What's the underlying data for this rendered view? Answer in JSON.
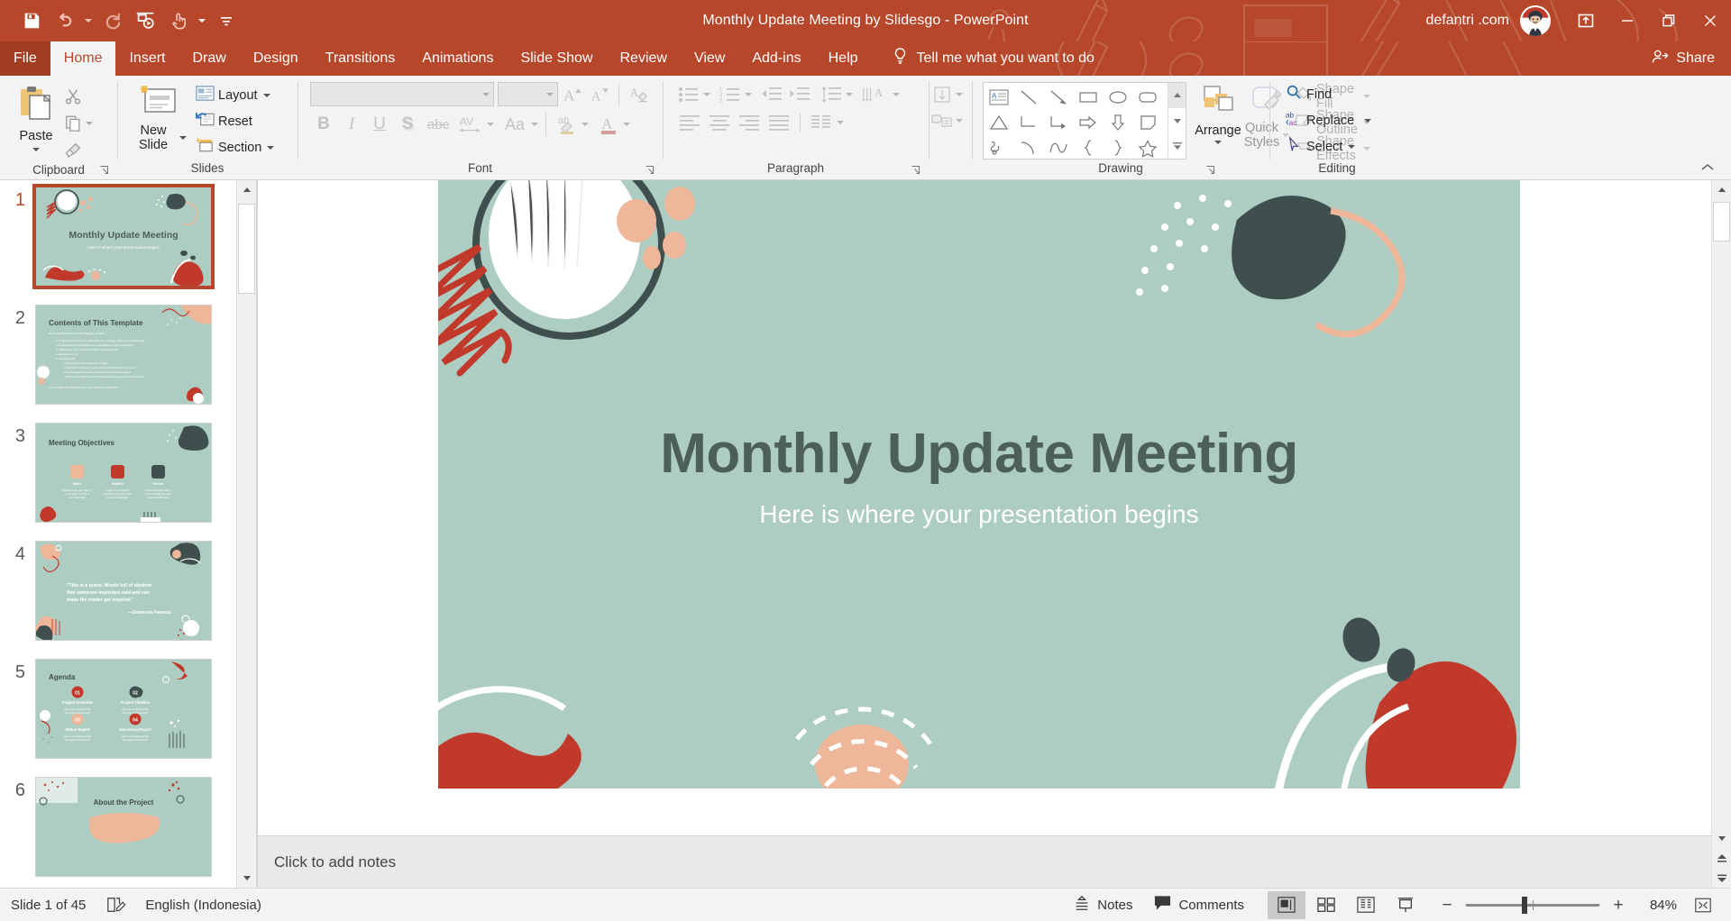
{
  "app": {
    "title": "Monthly Update Meeting by Slidesgo  -  PowerPoint",
    "account_name": "defantri .com",
    "brand_color": "#b7472a",
    "avatar_name": "user-avatar"
  },
  "quick_access": {
    "items": [
      {
        "name": "save-icon",
        "label": "Save"
      },
      {
        "name": "undo-icon",
        "label": "Undo"
      },
      {
        "name": "redo-icon",
        "label": "Redo"
      },
      {
        "name": "start-presentation-icon",
        "label": "Start From Beginning"
      },
      {
        "name": "touch-mode-icon",
        "label": "Touch/Mouse Mode"
      },
      {
        "name": "customize-quick-access-icon",
        "label": "Customize Quick Access Toolbar"
      }
    ]
  },
  "window_controls": [
    {
      "name": "ribbon-display-options-icon",
      "label": "Ribbon Display Options"
    },
    {
      "name": "minimize-icon",
      "label": "Minimize"
    },
    {
      "name": "restore-icon",
      "label": "Restore Down"
    },
    {
      "name": "close-icon",
      "label": "Close"
    }
  ],
  "tabs": [
    {
      "label": "File",
      "active": false,
      "file": true
    },
    {
      "label": "Home",
      "active": true
    },
    {
      "label": "Insert",
      "active": false
    },
    {
      "label": "Draw",
      "active": false
    },
    {
      "label": "Design",
      "active": false
    },
    {
      "label": "Transitions",
      "active": false
    },
    {
      "label": "Animations",
      "active": false
    },
    {
      "label": "Slide Show",
      "active": false
    },
    {
      "label": "Review",
      "active": false
    },
    {
      "label": "View",
      "active": false
    },
    {
      "label": "Add-ins",
      "active": false
    },
    {
      "label": "Help",
      "active": false
    }
  ],
  "tell_me": {
    "label": "Tell me what you want to do",
    "icon": "lightbulb-icon"
  },
  "share": {
    "label": "Share",
    "icon": "share-person-icon"
  },
  "ribbon": {
    "collapse_label": "Collapse the Ribbon",
    "groups": [
      {
        "name": "clipboard",
        "label": "Clipboard",
        "paste": "Paste",
        "items": [
          {
            "name": "cut-icon",
            "label": "Cut"
          },
          {
            "name": "copy-icon",
            "label": "Copy"
          },
          {
            "name": "format-painter-icon",
            "label": "Format Painter"
          }
        ]
      },
      {
        "name": "slides",
        "label": "Slides",
        "new_slide": "New Slide",
        "items": [
          {
            "name": "layout-button",
            "label": "Layout"
          },
          {
            "name": "reset-button",
            "label": "Reset"
          },
          {
            "name": "section-button",
            "label": "Section"
          }
        ]
      },
      {
        "name": "font",
        "label": "Font",
        "font_name_value": "",
        "font_size_value": "",
        "items": [
          {
            "name": "increase-font-size-icon",
            "label": "Increase Font Size"
          },
          {
            "name": "decrease-font-size-icon",
            "label": "Decrease Font Size"
          },
          {
            "name": "clear-formatting-icon",
            "label": "Clear All Formatting"
          },
          {
            "name": "bold-icon",
            "label": "B"
          },
          {
            "name": "italic-icon",
            "label": "I"
          },
          {
            "name": "underline-icon",
            "label": "U"
          },
          {
            "name": "text-shadow-icon",
            "label": "S"
          },
          {
            "name": "strikethrough-icon",
            "label": "abc"
          },
          {
            "name": "character-spacing-icon",
            "label": "AV"
          },
          {
            "name": "change-case-icon",
            "label": "Aa"
          },
          {
            "name": "text-highlight-color-icon",
            "label": "Text Highlight Color"
          },
          {
            "name": "font-color-icon",
            "label": "Font Color"
          }
        ]
      },
      {
        "name": "paragraph",
        "label": "Paragraph",
        "items": [
          {
            "name": "bullets-icon",
            "label": "Bullets"
          },
          {
            "name": "numbering-icon",
            "label": "Numbering"
          },
          {
            "name": "decrease-indent-icon",
            "label": "Decrease List Level"
          },
          {
            "name": "increase-indent-icon",
            "label": "Increase List Level"
          },
          {
            "name": "line-spacing-icon",
            "label": "Line Spacing"
          },
          {
            "name": "text-direction-icon",
            "label": "Text Direction"
          },
          {
            "name": "align-text-icon",
            "label": "Align Text"
          },
          {
            "name": "convert-to-smartart-icon",
            "label": "Convert to SmartArt"
          },
          {
            "name": "align-left-icon",
            "label": "Align Left"
          },
          {
            "name": "align-center-icon",
            "label": "Center"
          },
          {
            "name": "align-right-icon",
            "label": "Align Right"
          },
          {
            "name": "justify-icon",
            "label": "Justify"
          },
          {
            "name": "columns-icon",
            "label": "Add or Remove Columns"
          }
        ]
      },
      {
        "name": "drawing",
        "label": "Drawing",
        "arrange": "Arrange",
        "quick_styles": "Quick Styles",
        "shape_fill": "Shape Fill",
        "shape_outline": "Shape Outline",
        "shape_effects": "Shape Effects",
        "shapes": [
          "text-box-shape",
          "line-shape",
          "arrow-shape",
          "rectangle-shape",
          "oval-shape",
          "rounded-rectangle-shape",
          "triangle-shape",
          "elbow-connector-shape",
          "elbow-arrow-shape",
          "right-arrow-shape",
          "down-arrow-shape",
          "flowchart-shape",
          "scribble-shape",
          "arc-shape",
          "curve-shape",
          "left-brace-shape",
          "right-brace-shape",
          "star-shape"
        ]
      },
      {
        "name": "editing",
        "label": "Editing",
        "items": [
          {
            "name": "find-button",
            "label": "Find",
            "icon": "magnifier-icon"
          },
          {
            "name": "replace-button",
            "label": "Replace",
            "icon": "replace-icon"
          },
          {
            "name": "select-button",
            "label": "Select",
            "icon": "cursor-icon"
          }
        ]
      }
    ]
  },
  "thumbnails": {
    "scroll_up": "Scroll Up",
    "scroll_down": "Scroll Down",
    "slides": [
      {
        "number": "1",
        "selected": true,
        "kind": "title",
        "title": "Monthly Update Meeting",
        "subtitle": "Here is where your presentation begins"
      },
      {
        "number": "2",
        "selected": false,
        "kind": "contents",
        "title": "Contents of This Template"
      },
      {
        "number": "3",
        "selected": false,
        "kind": "objectives",
        "title": "Meeting Objectives",
        "cards": [
          {
            "name": "Mars",
            "text": "Despite being red, Mars is a cold place. It's full of iron oxide dust"
          },
          {
            "name": "Jupiter",
            "text": "Jupiter is the biggest planet in our Solar System and the fourth-brightest"
          },
          {
            "name": "Venus",
            "text": "Venus is a beautiful name, but is terribly hot, even hotter than Mercury"
          }
        ]
      },
      {
        "number": "4",
        "selected": false,
        "kind": "quote",
        "quote": "“This is a quote. Words full of wisdom that someone important said and can make the reader get inspired.”",
        "attribution": "—Someone Famous"
      },
      {
        "number": "5",
        "selected": false,
        "kind": "agenda",
        "title": "Agenda",
        "agenda": [
          {
            "num": "01",
            "name": "Project Schedule",
            "text": "Here you could describe the topic of the section"
          },
          {
            "num": "02",
            "name": "Project Timeline",
            "text": "Here you could describe the topic of the section"
          },
          {
            "num": "03",
            "name": "Status Report",
            "text": "Here you could describe the topic of the section"
          },
          {
            "num": "04",
            "name": "Upcoming Report",
            "text": "Here you could describe the topic of the section"
          }
        ]
      },
      {
        "number": "6",
        "selected": false,
        "kind": "about",
        "title": "About the Project"
      }
    ]
  },
  "slide": {
    "title": "Monthly Update Meeting",
    "subtitle": "Here is where your presentation begins",
    "background_color": "#aecdc2",
    "title_color": "#4d5f5a"
  },
  "notes": {
    "placeholder": "Click to add notes"
  },
  "status_bar": {
    "slide_counter": "Slide 1 of 45",
    "proofing_icon": "spell-check-icon",
    "language": "English (Indonesia)",
    "notes_label": "Notes",
    "comments_label": "Comments",
    "views": [
      {
        "name": "normal-view-button",
        "label": "Normal",
        "active": true
      },
      {
        "name": "slide-sorter-view-button",
        "label": "Slide Sorter",
        "active": false
      },
      {
        "name": "reading-view-button",
        "label": "Reading View",
        "active": false
      },
      {
        "name": "slide-show-button",
        "label": "Slide Show",
        "active": false
      }
    ],
    "zoom_out_label": "−",
    "zoom_in_label": "+",
    "zoom_level": "84%",
    "fit_label": "Fit slide to current window"
  }
}
